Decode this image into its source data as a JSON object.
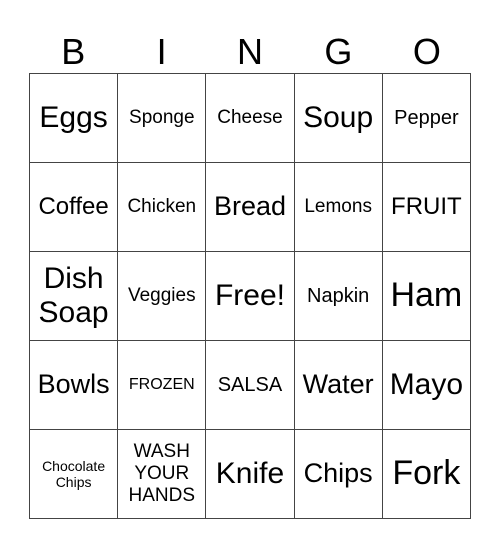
{
  "header": [
    "B",
    "I",
    "N",
    "G",
    "O"
  ],
  "rows": [
    [
      "Eggs",
      "Sponge",
      "Cheese",
      "Soup",
      "Pepper"
    ],
    [
      "Coffee",
      "Chicken",
      "Bread",
      "Lemons",
      "FRUIT"
    ],
    [
      "Dish Soap",
      "Veggies",
      "Free!",
      "Napkin",
      "Ham"
    ],
    [
      "Bowls",
      "FROZEN",
      "SALSA",
      "Water",
      "Mayo"
    ],
    [
      "Chocolate Chips",
      "WASH YOUR HANDS",
      "Knife",
      "Chips",
      "Fork"
    ]
  ]
}
